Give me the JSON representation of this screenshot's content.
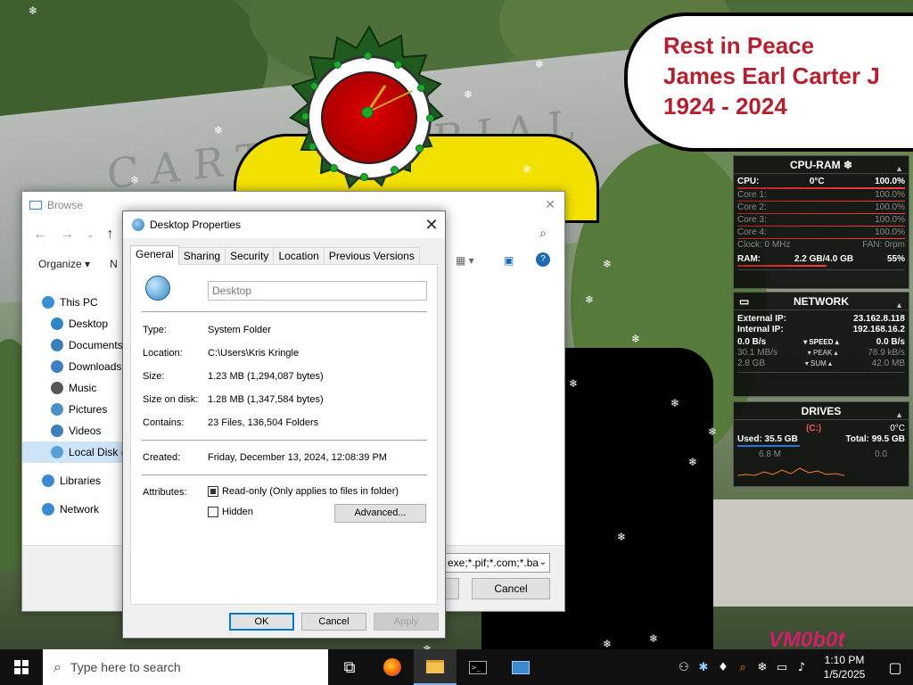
{
  "bubble": {
    "line1": "Rest in Peace",
    "line2": "James Earl Carter J",
    "line3": "1924 - 2024"
  },
  "wallpaper": {
    "sign_text": "CARTER  ORIAL"
  },
  "cpu_widget": {
    "title": "CPU-RAM",
    "cpu_label": "CPU:",
    "cpu_temp": "0°C",
    "cpu_pct": "100.0%",
    "cores": [
      {
        "label": "Core 1:",
        "value": "100.0%"
      },
      {
        "label": "Core 2:",
        "value": "100.0%"
      },
      {
        "label": "Core 3:",
        "value": "100.0%"
      },
      {
        "label": "Core 4:",
        "value": "100.0%"
      }
    ],
    "clock": "Clock: 0 MHz",
    "fan": "FAN: 0rpm",
    "ram_label": "RAM:",
    "ram_used": "2.2 GB/4.0 GB",
    "ram_pct": "55%"
  },
  "net_widget": {
    "title": "NETWORK",
    "ext_label": "External IP:",
    "ext_ip": "23.162.8.118",
    "int_label": "Internal IP:",
    "int_ip": "192.168.16.2",
    "speed_l": "0.0 B/s",
    "speed_tag": "▾ SPEED ▴",
    "speed_r": "0.0 B/s",
    "peak_l": "30.1 MB/s",
    "peak_tag": "▾ PEAK ▴",
    "peak_r": "78.9 kB/s",
    "sum_l": "2.8 GB",
    "sum_tag": "▾ SUM ▴",
    "sum_r": "42.0 MB"
  },
  "drives_widget": {
    "title": "DRIVES",
    "temp": "0°C",
    "drive": "(C:)",
    "used": "Used: 35.5 GB",
    "total": "Total: 99.5 GB",
    "read": "6.8 M",
    "write": "0.0"
  },
  "browse": {
    "title": "Browse",
    "organize": "Organize ▾",
    "organize_extra": "N",
    "tree": [
      {
        "label": "This PC",
        "color": "#3b8fd6",
        "indent": 22
      },
      {
        "label": "Desktop",
        "color": "#2f86c6",
        "indent": 32
      },
      {
        "label": "Documents",
        "color": "#3a7fb8",
        "indent": 32
      },
      {
        "label": "Downloads",
        "color": "#3d7fc0",
        "indent": 32
      },
      {
        "label": "Music",
        "color": "#555555",
        "indent": 32
      },
      {
        "label": "Pictures",
        "color": "#4a90c8",
        "indent": 32
      },
      {
        "label": "Videos",
        "color": "#3e80b6",
        "indent": 32
      },
      {
        "label": "Local Disk (",
        "color": "#5aa0d8",
        "indent": 32
      },
      {
        "label": "Libraries",
        "color": "#3a8ad0",
        "indent": 22
      },
      {
        "label": "Network",
        "color": "#3a8ad0",
        "indent": 22
      }
    ],
    "filter_value": "exe;*.pif;*.com;*.ba",
    "cancel_label": "Cancel"
  },
  "props": {
    "title": "Desktop Properties",
    "tabs": [
      "General",
      "Sharing",
      "Security",
      "Location",
      "Previous Versions"
    ],
    "name_value": "Desktop",
    "type_label": "Type:",
    "type_value": "System Folder",
    "location_label": "Location:",
    "location_value": "C:\\Users\\Kris Kringle",
    "size_label": "Size:",
    "size_value": "1.23 MB (1,294,087 bytes)",
    "sod_label": "Size on disk:",
    "sod_value": "1.28 MB (1,347,584 bytes)",
    "contains_label": "Contains:",
    "contains_value": "23 Files, 136,504 Folders",
    "created_label": "Created:",
    "created_value": "Friday, December 13, 2024, 12:08:39 PM",
    "attributes_label": "Attributes:",
    "readonly_label": "Read-only (Only applies to files in folder)",
    "readonly_checked": true,
    "hidden_label": "Hidden",
    "hidden_checked": false,
    "advanced_label": "Advanced...",
    "ok_label": "OK",
    "cancel_label": "Cancel",
    "apply_label": "Apply"
  },
  "taskbar": {
    "search_placeholder": "Type here to search",
    "time": "1:10 PM",
    "date": "1/5/2025"
  },
  "watermark": "VM0b0t"
}
